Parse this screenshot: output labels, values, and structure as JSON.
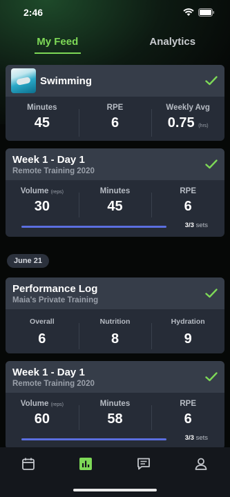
{
  "status": {
    "time": "2:46"
  },
  "tabs": [
    {
      "label": "My Feed",
      "active": true
    },
    {
      "label": "Analytics",
      "active": false
    }
  ],
  "colors": {
    "accent": "#7ed957",
    "progress": "#5b6fe0",
    "card": "#262c37",
    "card_head": "#363d49"
  },
  "cards": [
    {
      "title": "Swimming",
      "icon": "swimming-thumbnail",
      "stats": [
        {
          "label": "Minutes",
          "value": "45"
        },
        {
          "label": "RPE",
          "value": "6"
        },
        {
          "label": "Weekly Avg",
          "value": "0.75",
          "unit": "(hrs)"
        }
      ]
    },
    {
      "title": "Week 1 - Day 1",
      "subtitle": "Remote Training 2020",
      "stats": [
        {
          "label": "Volume",
          "label_unit": "(reps)",
          "value": "30"
        },
        {
          "label": "Minutes",
          "value": "45"
        },
        {
          "label": "RPE",
          "value": "6"
        }
      ],
      "progress": {
        "fraction": 1.0,
        "done": "3/3",
        "suffix": "sets"
      }
    },
    {
      "title": "Performance Log",
      "subtitle": "Maia's Private Training",
      "stats": [
        {
          "label": "Overall",
          "value": "6"
        },
        {
          "label": "Nutrition",
          "value": "8"
        },
        {
          "label": "Hydration",
          "value": "9"
        }
      ]
    },
    {
      "title": "Week 1 - Day 1",
      "subtitle": "Remote Training 2020",
      "stats": [
        {
          "label": "Volume",
          "label_unit": "(reps)",
          "value": "60"
        },
        {
          "label": "Minutes",
          "value": "58"
        },
        {
          "label": "RPE",
          "value": "6"
        }
      ],
      "progress": {
        "fraction": 1.0,
        "done": "3/3",
        "suffix": "sets"
      }
    }
  ],
  "date_divider": "June 21",
  "bottom_nav": [
    {
      "icon": "calendar-icon",
      "active": false
    },
    {
      "icon": "bar-chart-icon",
      "active": true
    },
    {
      "icon": "message-icon",
      "active": false
    },
    {
      "icon": "profile-icon",
      "active": false
    }
  ]
}
